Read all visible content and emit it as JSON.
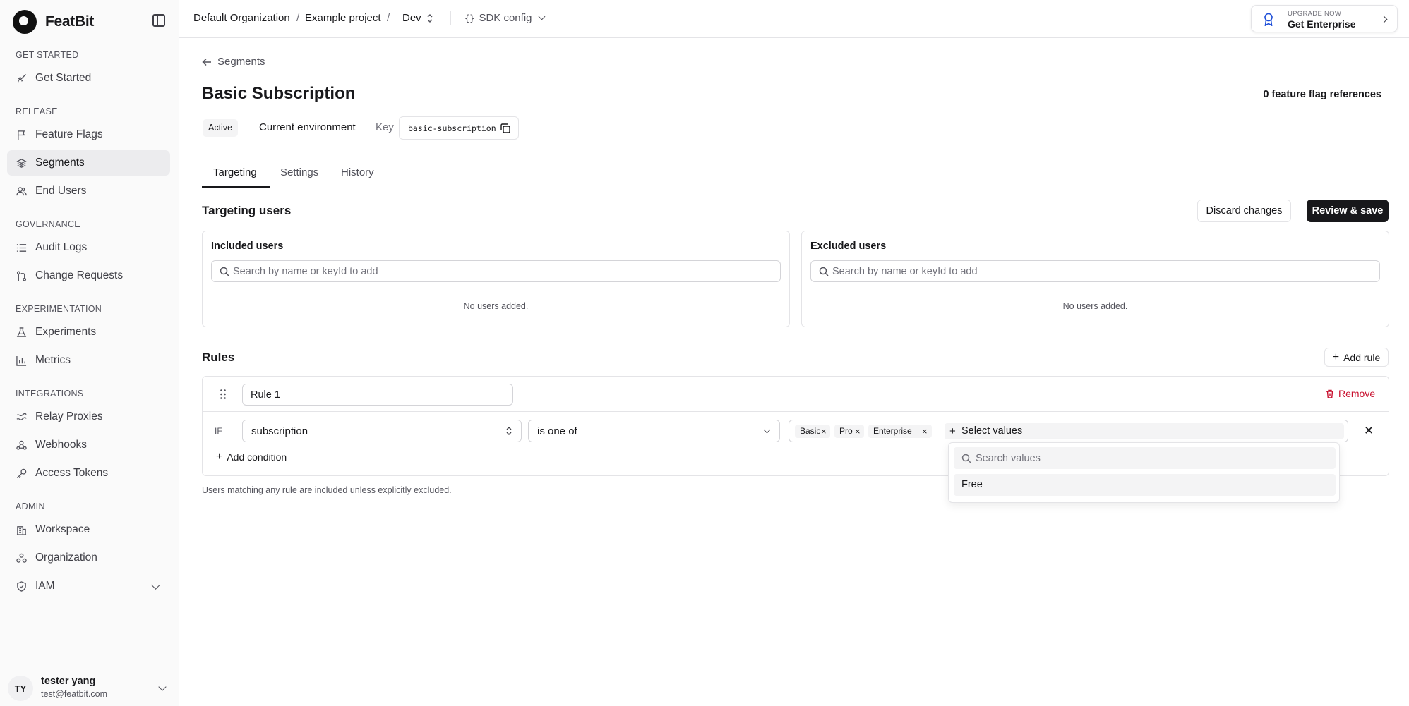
{
  "app": {
    "name": "FeatBit"
  },
  "sidebar": {
    "sections": [
      {
        "title": "GET STARTED",
        "items": [
          {
            "label": "Get Started",
            "icon": "rocket-icon"
          }
        ]
      },
      {
        "title": "RELEASE",
        "items": [
          {
            "label": "Feature Flags",
            "icon": "flag-icon"
          },
          {
            "label": "Segments",
            "icon": "layers-icon",
            "active": true
          },
          {
            "label": "End Users",
            "icon": "users-icon"
          }
        ]
      },
      {
        "title": "GOVERNANCE",
        "items": [
          {
            "label": "Audit Logs",
            "icon": "list-icon"
          },
          {
            "label": "Change Requests",
            "icon": "git-pull-request-icon"
          }
        ]
      },
      {
        "title": "EXPERIMENTATION",
        "items": [
          {
            "label": "Experiments",
            "icon": "flask-icon"
          },
          {
            "label": "Metrics",
            "icon": "bar-chart-icon"
          }
        ]
      },
      {
        "title": "INTEGRATIONS",
        "items": [
          {
            "label": "Relay Proxies",
            "icon": "relay-icon"
          },
          {
            "label": "Webhooks",
            "icon": "webhook-icon"
          },
          {
            "label": "Access Tokens",
            "icon": "key-icon"
          }
        ]
      },
      {
        "title": "ADMIN",
        "items": [
          {
            "label": "Workspace",
            "icon": "building-icon"
          },
          {
            "label": "Organization",
            "icon": "organization-icon"
          },
          {
            "label": "IAM",
            "icon": "shield-icon"
          }
        ]
      }
    ],
    "user": {
      "initials": "TY",
      "name": "tester yang",
      "email": "test@featbit.com"
    }
  },
  "topbar": {
    "organization": "Default Organization",
    "project": "Example project",
    "environment": "Dev",
    "separator": "/",
    "sdk_config": "SDK config",
    "upgrade_small": "UPGRADE NOW",
    "upgrade_big": "Get Enterprise"
  },
  "page": {
    "back_label": "Segments",
    "title": "Basic Subscription",
    "flag_references": "0 feature flag references",
    "status": "Active",
    "scope": "Current environment",
    "key_label": "Key",
    "key_value": "basic-subscription",
    "tabs": [
      "Targeting",
      "Settings",
      "History"
    ],
    "active_tab": "Targeting"
  },
  "targeting": {
    "title": "Targeting users",
    "discard_label": "Discard changes",
    "save_label": "Review & save",
    "included": {
      "title": "Included users",
      "placeholder": "Search by name or keyId to add",
      "empty": "No users added."
    },
    "excluded": {
      "title": "Excluded users",
      "placeholder": "Search by name or keyId to add",
      "empty": "No users added."
    }
  },
  "rules": {
    "title": "Rules",
    "add_rule_label": "Add rule",
    "items": [
      {
        "name": "Rule 1",
        "remove_label": "Remove",
        "condition": {
          "if_label": "IF",
          "attribute": "subscription",
          "operator": "is one of",
          "values": [
            "Basic",
            "Pro",
            "Enterprise"
          ],
          "select_placeholder": "Select values"
        },
        "add_condition_label": "Add condition"
      }
    ],
    "footnote": "Users matching any rule are included unless explicitly excluded.",
    "dropdown": {
      "search_placeholder": "Search values",
      "options": [
        "Free"
      ]
    }
  },
  "colors": {
    "accent_dark": "#18181b",
    "danger": "#c8102e",
    "upgrade_icon": "#1d4ed8"
  }
}
